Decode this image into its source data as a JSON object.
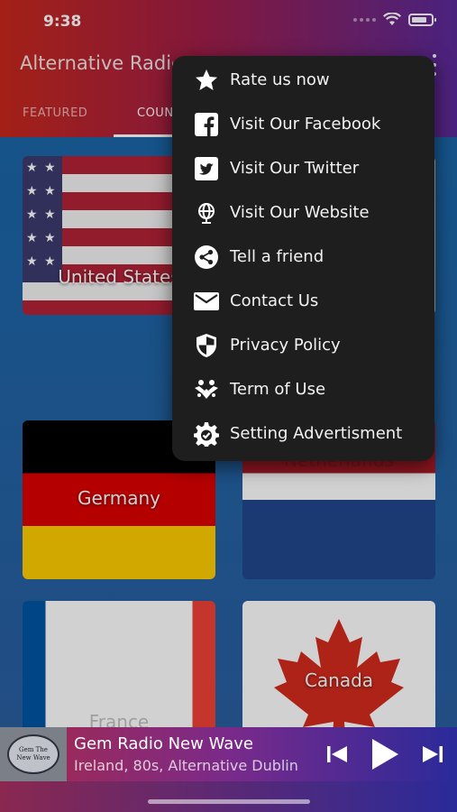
{
  "status": {
    "time": "9:38"
  },
  "app_bar": {
    "title": "Alternative Radio"
  },
  "tabs": [
    {
      "label": "FEATURED"
    },
    {
      "label": "COUNTRIES"
    }
  ],
  "countries": [
    {
      "name": "United States"
    },
    {
      "name": "Germany"
    },
    {
      "name": "Netherlands"
    },
    {
      "name": "France"
    },
    {
      "name": "Canada"
    }
  ],
  "menu": {
    "items": [
      {
        "label": "Rate us now",
        "icon": "star-icon"
      },
      {
        "label": "Visit Our Facebook",
        "icon": "facebook-icon"
      },
      {
        "label": "Visit Our Twitter",
        "icon": "twitter-icon"
      },
      {
        "label": "Visit Our Website",
        "icon": "globe-icon"
      },
      {
        "label": "Tell a friend",
        "icon": "share-icon"
      },
      {
        "label": "Contact Us",
        "icon": "mail-icon"
      },
      {
        "label": "Privacy Policy",
        "icon": "shield-icon"
      },
      {
        "label": "Term of Use",
        "icon": "handshake-icon"
      },
      {
        "label": "Setting Advertisment",
        "icon": "gear-icon"
      }
    ]
  },
  "player": {
    "station": "Gem Radio New Wave",
    "details": "Ireland, 80s, Alternative   Dublin",
    "logo_text": [
      "Gem The",
      "New Wave"
    ]
  }
}
